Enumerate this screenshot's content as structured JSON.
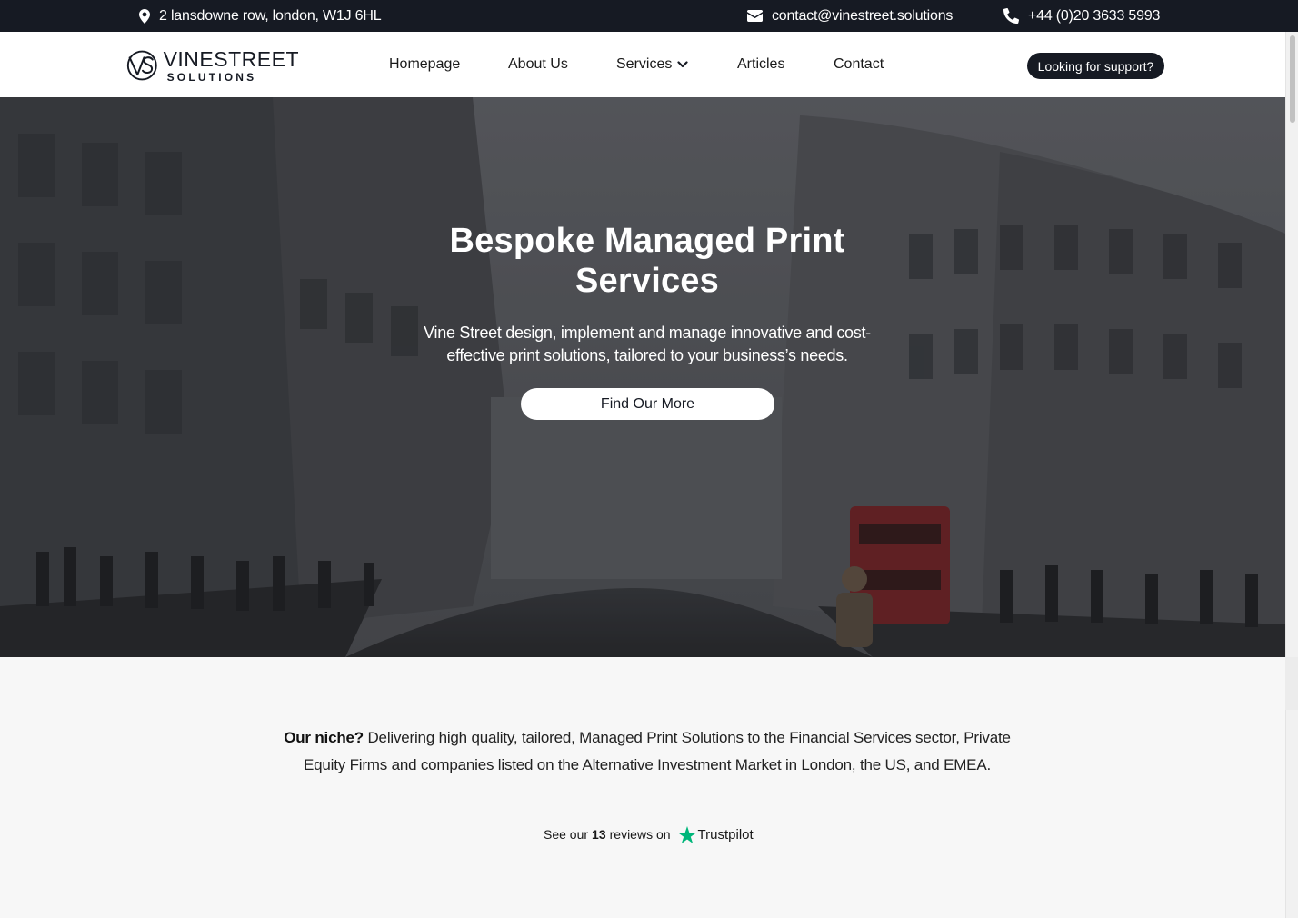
{
  "topbar": {
    "address": "2 lansdowne row, london, W1J 6HL",
    "email": "contact@vinestreet.solutions",
    "phone": "+44 (0)20 3633 5993",
    "icons": {
      "address": "map-pin-icon",
      "email": "envelope-icon",
      "phone": "phone-icon"
    }
  },
  "header": {
    "logo": {
      "line1": "VINESTREET",
      "line2": "SOLUTIONS",
      "mark": "VS"
    },
    "nav": [
      {
        "label": "Homepage"
      },
      {
        "label": "About Us"
      },
      {
        "label": "Services",
        "has_dropdown": true
      },
      {
        "label": "Articles"
      },
      {
        "label": "Contact"
      }
    ],
    "support_button": "Looking for support?"
  },
  "hero": {
    "title": "Bespoke Managed Print Services",
    "subtitle": "Vine Street design, implement and manage innovative and cost-effective print solutions, tailored to your business’s needs.",
    "cta": "Find Our More"
  },
  "niche": {
    "lead": "Our niche?",
    "text": "Delivering high quality, tailored, Managed Print Solutions to the Financial Services sector, Private Equity Firms and companies listed on the Alternative Investment Market in London, the US, and EMEA."
  },
  "trustpilot": {
    "prefix": "See our",
    "count": "13",
    "suffix": "reviews on",
    "brand": "Trustpilot",
    "star_color": "#00b67a"
  },
  "colors": {
    "dark": "#161a23",
    "white": "#ffffff",
    "page_bg": "#f7f7f7"
  }
}
